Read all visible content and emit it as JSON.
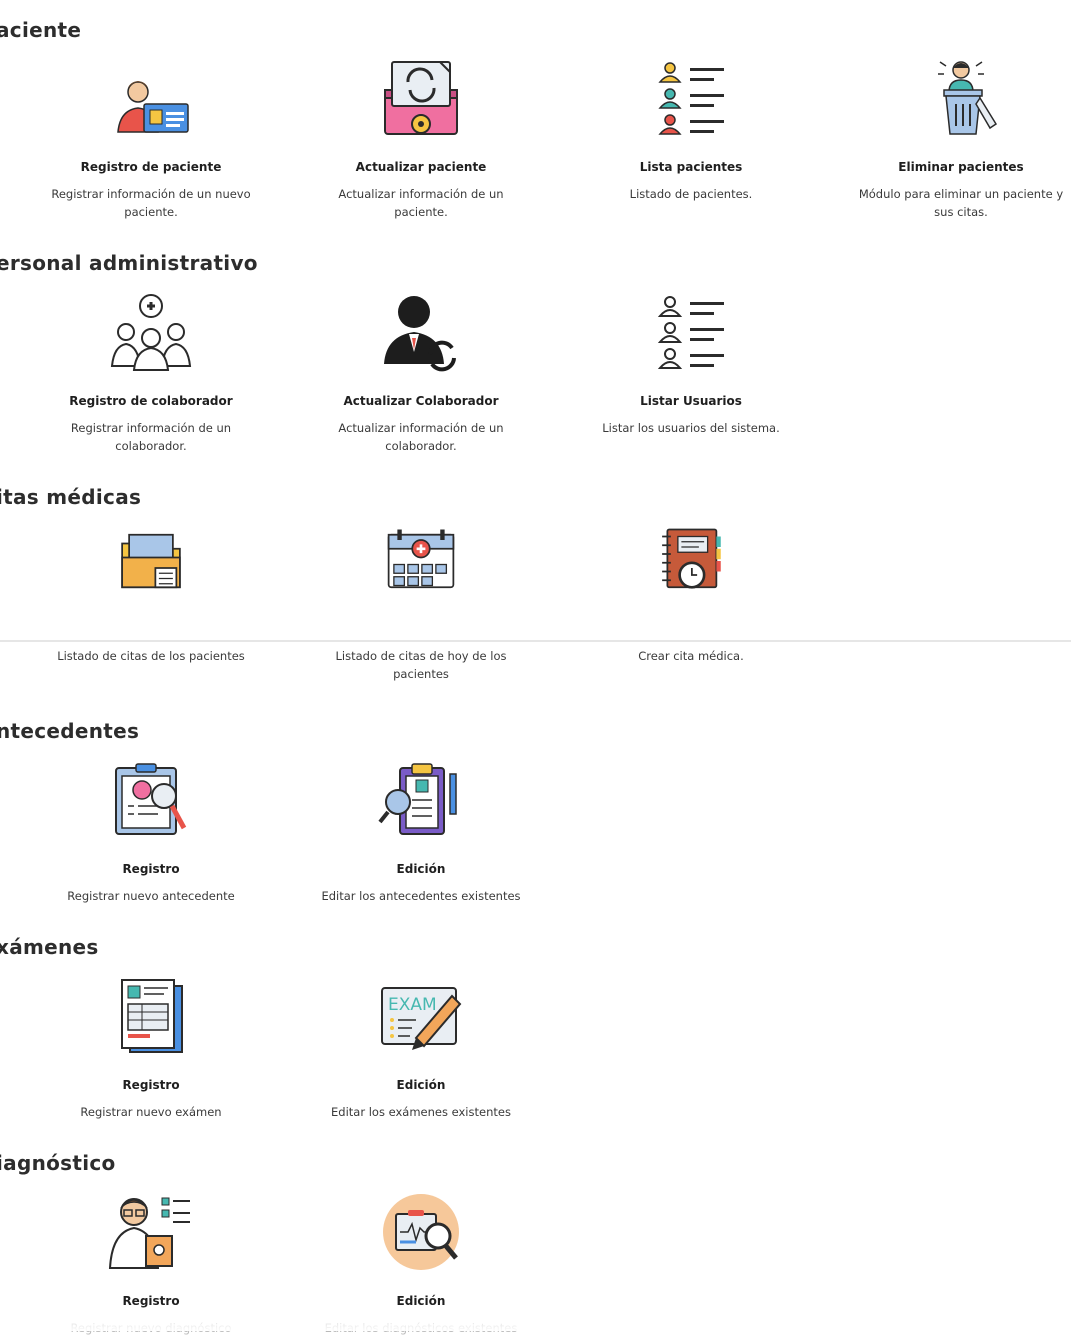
{
  "sections": [
    {
      "title": "aciente",
      "cards": [
        {
          "title": "Registro de paciente",
          "desc": "Registrar información de un nuevo paciente.",
          "icon": "patient-id-card-icon"
        },
        {
          "title": "Actualizar paciente",
          "desc": "Actualizar información de un paciente.",
          "icon": "refresh-browser-icon"
        },
        {
          "title": "Lista pacientes",
          "desc": "Listado de pacientes.",
          "icon": "user-list-icon"
        },
        {
          "title": "Eliminar pacientes",
          "desc": "Módulo para eliminar un paciente y sus citas.",
          "icon": "user-trash-icon"
        }
      ]
    },
    {
      "title": "ersonal administrativo",
      "cards": [
        {
          "title": "Registro de colaborador",
          "desc": "Registrar información de un colaborador.",
          "icon": "medical-team-icon"
        },
        {
          "title": "Actualizar Colaborador",
          "desc": "Actualizar información de un colaborador.",
          "icon": "businessman-sync-icon"
        },
        {
          "title": "Listar Usuarios",
          "desc": "Listar los usuarios del sistema.",
          "icon": "users-list-outline-icon"
        }
      ]
    },
    {
      "title": "itas médicas",
      "cards": [
        {
          "title": "",
          "desc": "Listado de citas de los pacientes",
          "icon": "folder-icon"
        },
        {
          "title": "",
          "desc": "Listado de citas de hoy de los pacientes",
          "icon": "medical-calendar-icon"
        },
        {
          "title": "",
          "desc": "Crear cita médica.",
          "icon": "notebook-clock-icon"
        }
      ]
    },
    {
      "title": "ntecedentes",
      "cards": [
        {
          "title": "Registro",
          "desc": "Registrar nuevo antecedente",
          "icon": "clipboard-search-icon"
        },
        {
          "title": "Edición",
          "desc": "Editar los antecedentes existentes",
          "icon": "clipboard-magnifier-icon"
        }
      ]
    },
    {
      "title": "xámenes",
      "cards": [
        {
          "title": "Registro",
          "desc": "Registrar nuevo exámen",
          "icon": "medical-report-icon"
        },
        {
          "title": "Edición",
          "desc": "Editar los exámenes existentes",
          "icon": "exam-pencil-icon",
          "icon_text": "EXAM"
        }
      ]
    },
    {
      "title": "iagnóstico",
      "cards": [
        {
          "title": "Registro",
          "desc": "Registrar nuevo diagnóstico",
          "icon": "doctor-checklist-icon"
        },
        {
          "title": "Edición",
          "desc": "Editar los diagnósticos existentes",
          "icon": "report-magnifier-icon"
        }
      ]
    }
  ],
  "colors": {
    "orange": "#f2a65a",
    "red": "#e8544a",
    "blue": "#4a90e2",
    "teal": "#46b8b0",
    "pink": "#f06fa0",
    "yellow": "#f5c542",
    "dark": "#2b2b2b"
  }
}
